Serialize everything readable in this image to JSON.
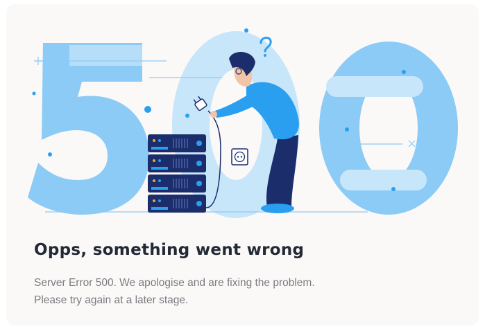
{
  "error": {
    "code_illustration": "500",
    "title": "Opps, something went wrong",
    "message_line1": "Server Error 500. We apologise and are fixing the problem.",
    "message_line2": "Please try again at a later stage."
  },
  "colors": {
    "card_bg": "#fbf8f8",
    "digit_dark": "#8ccbf5",
    "digit_light": "#c8e6fa",
    "accent": "#2a9ff0",
    "navy": "#1b2d6b",
    "title": "#222a35",
    "text": "#7a7b80"
  }
}
